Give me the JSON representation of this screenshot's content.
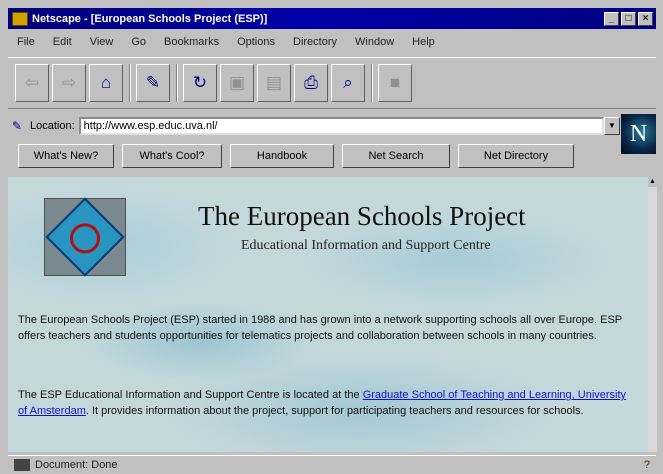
{
  "window": {
    "title": "Netscape - [European Schools Project (ESP)]",
    "controls": [
      "_",
      "□",
      "×"
    ]
  },
  "menu": [
    "File",
    "Edit",
    "View",
    "Go",
    "Bookmarks",
    "Options",
    "Directory",
    "Window",
    "Help"
  ],
  "toolbar": {
    "buttons": [
      {
        "name": "back",
        "glyph": "⇦",
        "enabled": false
      },
      {
        "name": "forward",
        "glyph": "⇨",
        "enabled": false
      },
      {
        "name": "home",
        "glyph": "⌂",
        "enabled": true
      },
      {
        "name": "edit",
        "glyph": "✎",
        "enabled": true
      },
      {
        "name": "reload",
        "glyph": "↻",
        "enabled": true
      },
      {
        "name": "images",
        "glyph": "▣",
        "enabled": false
      },
      {
        "name": "open",
        "glyph": "▤",
        "enabled": false
      },
      {
        "name": "print",
        "glyph": "⎙",
        "enabled": true
      },
      {
        "name": "find",
        "glyph": "⌕",
        "enabled": true
      },
      {
        "name": "stop",
        "glyph": "■",
        "enabled": false
      }
    ]
  },
  "address": {
    "label": "Location:",
    "value": "http://www.esp.educ.uva.nl/"
  },
  "directory_buttons": [
    "What's New?",
    "What's Cool?",
    "Handbook",
    "Net Search",
    "Net Directory"
  ],
  "page": {
    "title": "The European Schools Project",
    "subtitle": "Educational Information and Support Centre",
    "para1": "The European Schools Project (ESP) started in 1988 and has grown into a network supporting schools all over Europe. ESP offers teachers and students opportunities for telematics projects and collaboration between schools in many countries.",
    "para2_before_link": "The ESP Educational Information and Support Centre is located at the ",
    "para2_link": "Graduate School of Teaching and Learning, University of Amsterdam",
    "para2_after_link": ". It provides information about the project, support for participating teachers and resources for schools."
  },
  "status": {
    "text": "Document: Done",
    "security": "?"
  }
}
